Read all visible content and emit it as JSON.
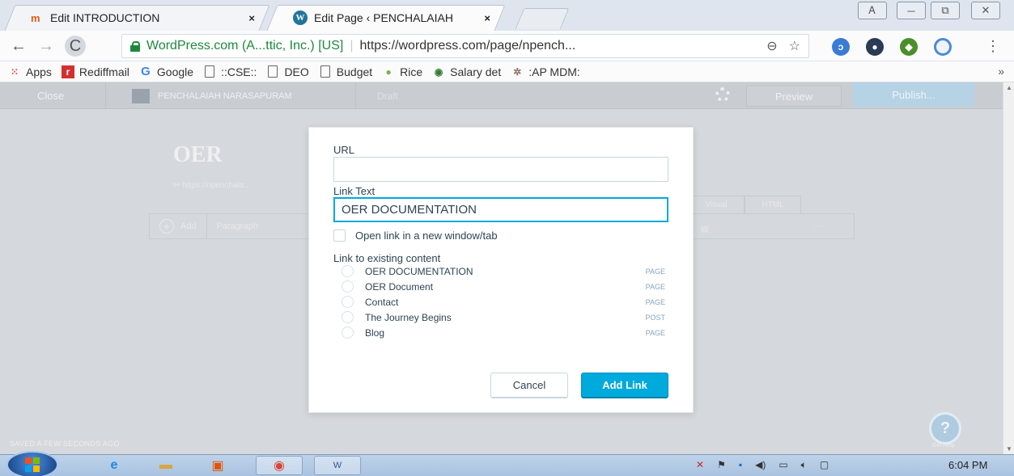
{
  "browser": {
    "tabs": [
      {
        "title": "Edit INTRODUCTION",
        "close": "×",
        "favicon": "m-icon"
      },
      {
        "title": "Edit Page ‹ PENCHALAIAH",
        "close": "×",
        "favicon": "wordpress-icon"
      }
    ],
    "window_controls": [
      "person-icon",
      "minimize-icon",
      "restore-icon",
      "close-icon"
    ],
    "window_glyphs": {
      "person": "Ꭺ",
      "minimize": "─",
      "restore": "⧉",
      "close": "✕"
    },
    "nav": {
      "back": "←",
      "forward": "→",
      "reload": "C"
    },
    "address": {
      "secure_text": "WordPress.com (A...ttic, Inc.) [US]",
      "separator": "|",
      "url": "https://wordpress.com/page/npench...",
      "zoom_icon": "⊖",
      "star_icon": "☆"
    },
    "menu_icon": "⋮",
    "bookmarks": [
      {
        "label": "Apps",
        "icon": "apps-grid-icon"
      },
      {
        "label": "Rediffmail",
        "icon": "rediff-icon"
      },
      {
        "label": "Google",
        "icon": "google-icon"
      },
      {
        "label": "::CSE::",
        "icon": "page-icon"
      },
      {
        "label": "DEO",
        "icon": "page-icon"
      },
      {
        "label": "Budget",
        "icon": "page-icon"
      },
      {
        "label": "Rice",
        "icon": "rice-icon"
      },
      {
        "label": "Salary det",
        "icon": "salary-icon"
      },
      {
        "label": ":AP MDM:",
        "icon": "mdm-icon"
      }
    ],
    "bookmarks_more": "»"
  },
  "editor": {
    "close": "Close",
    "site_name": "PENCHALAIAH NARASAPURAM",
    "status": "Draft",
    "preview": "Preview",
    "publish": "Publish...",
    "page_title": "OER",
    "permalink": "https://npenchala...",
    "add_label": "Add",
    "format": "Paragraph",
    "mode_visual": "Visual",
    "mode_html": "HTML",
    "more": "···",
    "saved": "SAVED A FEW SECONDS AGO",
    "help_label": "Get Help",
    "help_icon": "?"
  },
  "dialog": {
    "url_label": "URL",
    "url_value": "",
    "link_text_label": "Link Text",
    "link_text_value": "OER DOCUMENTATION",
    "new_window_label": "Open link in a new window/tab",
    "existing_label": "Link to existing content",
    "existing_items": [
      {
        "title": "OER DOCUMENTATION",
        "type": "PAGE"
      },
      {
        "title": "OER Document",
        "type": "PAGE"
      },
      {
        "title": "Contact",
        "type": "PAGE"
      },
      {
        "title": "The Journey Begins",
        "type": "POST"
      },
      {
        "title": "Blog",
        "type": "PAGE"
      }
    ],
    "cancel": "Cancel",
    "add_link": "Add Link"
  },
  "taskbar": {
    "apps": [
      "internet-explorer-icon",
      "file-explorer-icon",
      "media-player-icon",
      "chrome-icon",
      "word-icon"
    ],
    "time": "6:04 PM"
  },
  "colors": {
    "accent": "#00aadc",
    "secure_green": "#1b8a3c",
    "dialog_text": "#2e4453"
  }
}
